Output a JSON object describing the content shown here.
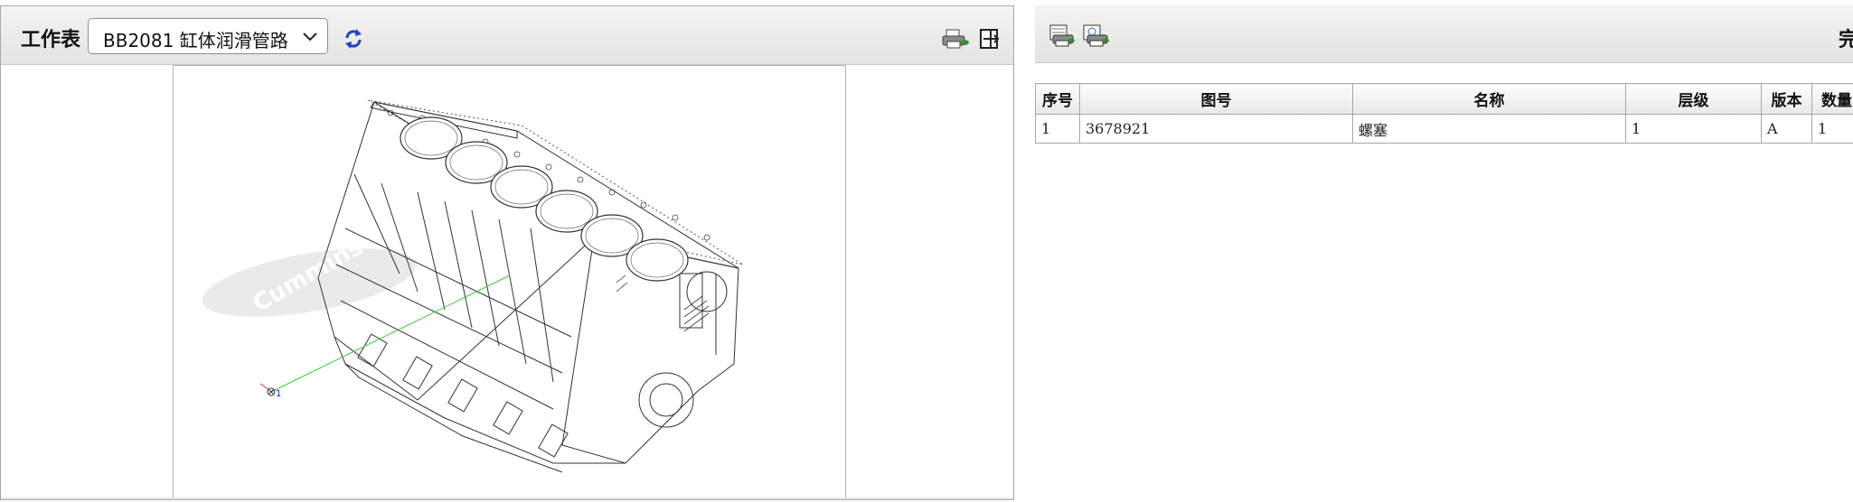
{
  "workspace": {
    "label": "工作表",
    "selected_assembly": "BB2081 缸体润滑管路"
  },
  "icons": {
    "refresh": "refresh-icon",
    "print": "printer-icon",
    "export": "export-icon"
  },
  "drawing": {
    "callout_number": "1",
    "watermark": "Cummins"
  },
  "right_toolbar": {
    "cut_text": "完"
  },
  "parts_table": {
    "headers": [
      "序号",
      "图号",
      "名称",
      "层级",
      "版本",
      "数量"
    ],
    "rows": [
      {
        "index": "1",
        "part_number": "3678921",
        "name": "螺塞",
        "level": "1",
        "version": "A",
        "quantity": "1"
      }
    ]
  },
  "colors": {
    "toolbar_bg": "#e8e8e5",
    "leader_line": "#33cc33",
    "callout_text": "#1a1ae0"
  }
}
